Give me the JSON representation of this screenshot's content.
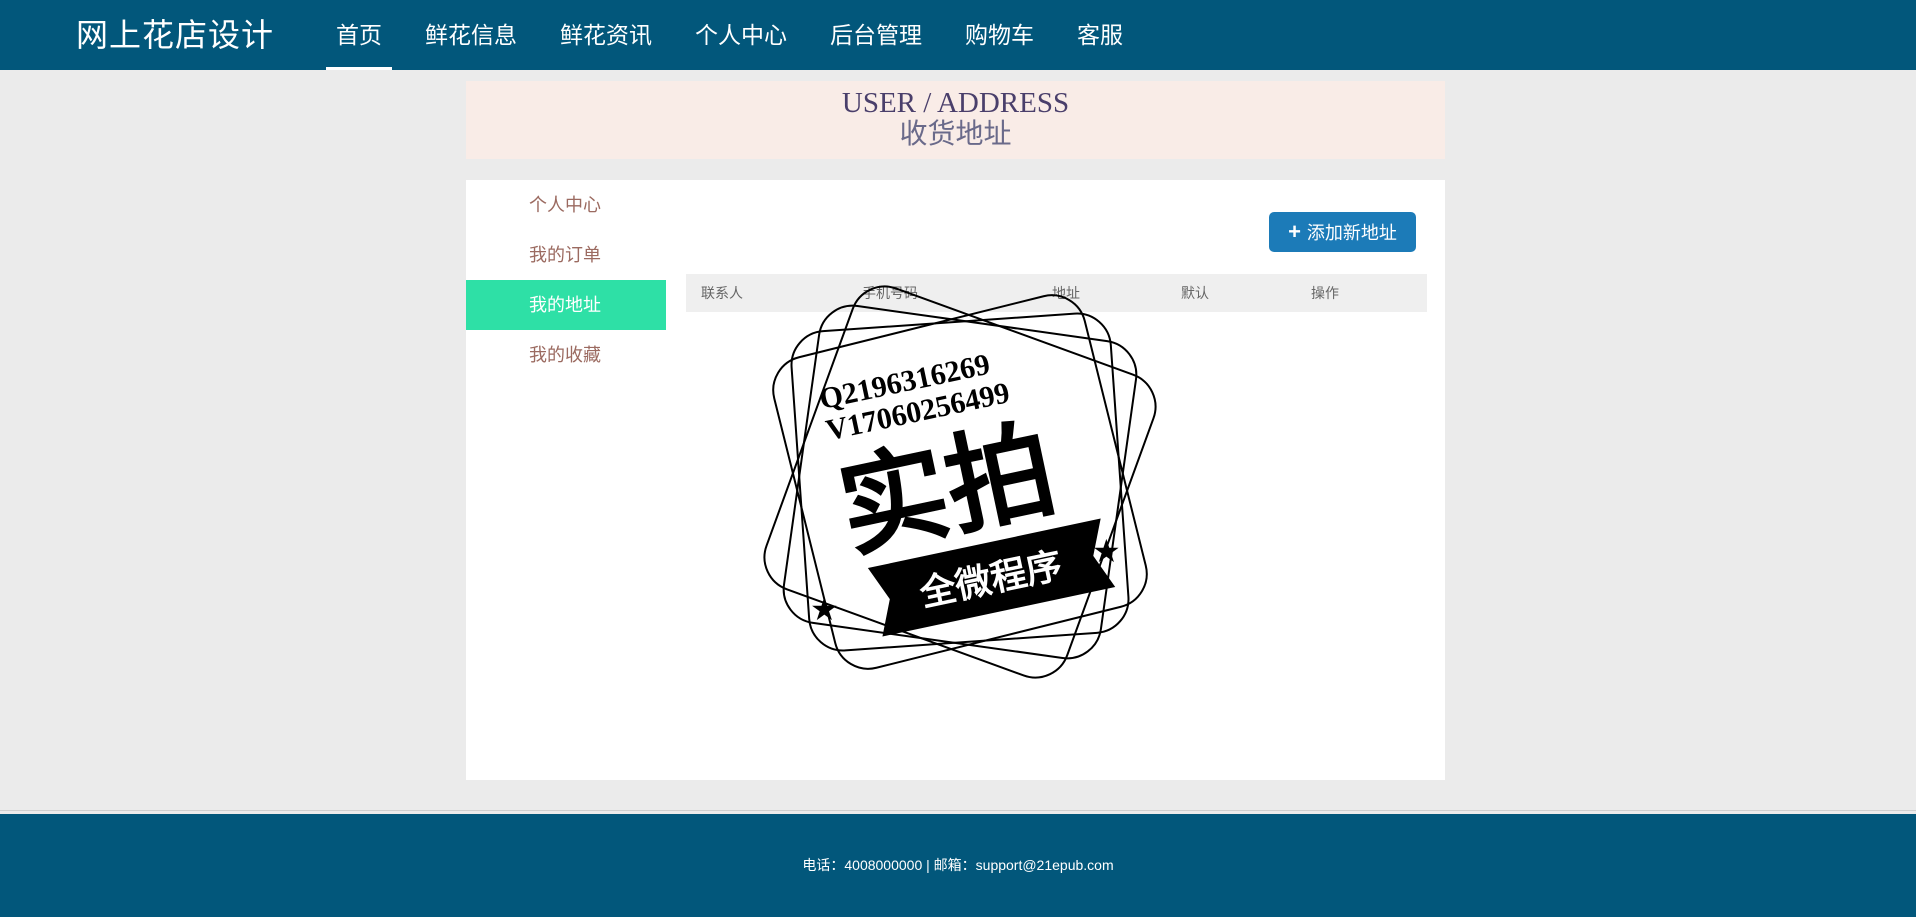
{
  "header": {
    "brand": "网上花店设计",
    "nav": [
      "首页",
      "鲜花信息",
      "鲜花资讯",
      "个人中心",
      "后台管理",
      "购物车",
      "客服"
    ]
  },
  "banner": {
    "en": "USER / ADDRESS",
    "cn": "收货地址"
  },
  "sidebar": {
    "items": [
      "个人中心",
      "我的订单",
      "我的地址",
      "我的收藏"
    ],
    "active": "我的地址"
  },
  "actions": {
    "add_plus": "+",
    "add_label": "添加新地址"
  },
  "table": {
    "headers": [
      "联系人",
      "手机号码",
      "地址",
      "默认",
      "操作"
    ]
  },
  "watermark": {
    "line1": "Q2196316269",
    "line2": "V17060256499",
    "big": "实拍",
    "ribbon": "全微程序"
  },
  "footer": {
    "text": "电话：4008000000 | 邮箱：support@21epub.com"
  },
  "colors": {
    "header_bg": "#02577b",
    "active_side": "#2ee0a6",
    "button": "#1c7bb8",
    "banner_bg": "#f9ece7"
  }
}
